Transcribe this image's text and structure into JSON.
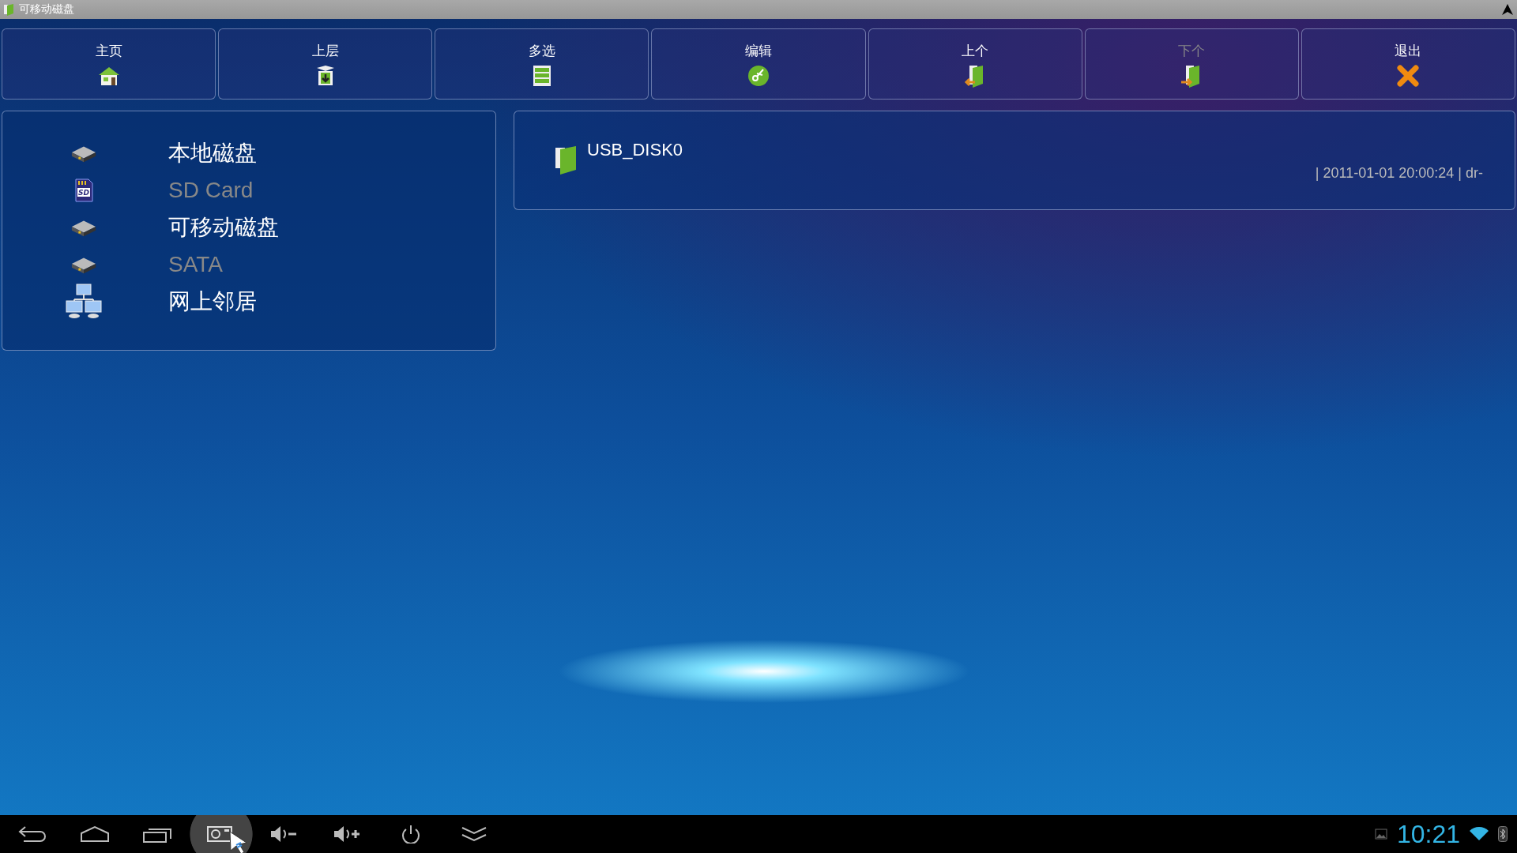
{
  "window": {
    "title": "可移动磁盘"
  },
  "toolbar": [
    {
      "label": "主页",
      "kind": "home",
      "disabled": false
    },
    {
      "label": "上层",
      "kind": "up",
      "disabled": false
    },
    {
      "label": "多选",
      "kind": "multi",
      "disabled": false
    },
    {
      "label": "编辑",
      "kind": "edit",
      "disabled": false
    },
    {
      "label": "上个",
      "kind": "prev",
      "disabled": false
    },
    {
      "label": "下个",
      "kind": "next",
      "disabled": true
    },
    {
      "label": "退出",
      "kind": "exit",
      "disabled": false
    }
  ],
  "sidebar": {
    "items": [
      {
        "label": "本地磁盘",
        "kind": "drive",
        "disabled": false
      },
      {
        "label": "SD Card",
        "kind": "sd",
        "disabled": true,
        "icon_text": "SD"
      },
      {
        "label": "可移动磁盘",
        "kind": "drive",
        "disabled": false
      },
      {
        "label": "SATA",
        "kind": "drive",
        "disabled": true
      },
      {
        "label": "网上邻居",
        "kind": "network",
        "disabled": false
      }
    ]
  },
  "files": [
    {
      "name": "USB_DISK0",
      "details": "| 2011-01-01 20:00:24 | dr-"
    }
  ],
  "nav_bar": {
    "buttons": [
      {
        "kind": "back",
        "selected": false
      },
      {
        "kind": "home",
        "selected": false
      },
      {
        "kind": "recents",
        "selected": false
      },
      {
        "kind": "screenshot",
        "selected": true
      },
      {
        "kind": "volume-down",
        "selected": false
      },
      {
        "kind": "volume-up",
        "selected": false
      },
      {
        "kind": "power",
        "selected": false
      },
      {
        "kind": "collapse",
        "selected": false
      }
    ],
    "time": "10:21"
  }
}
